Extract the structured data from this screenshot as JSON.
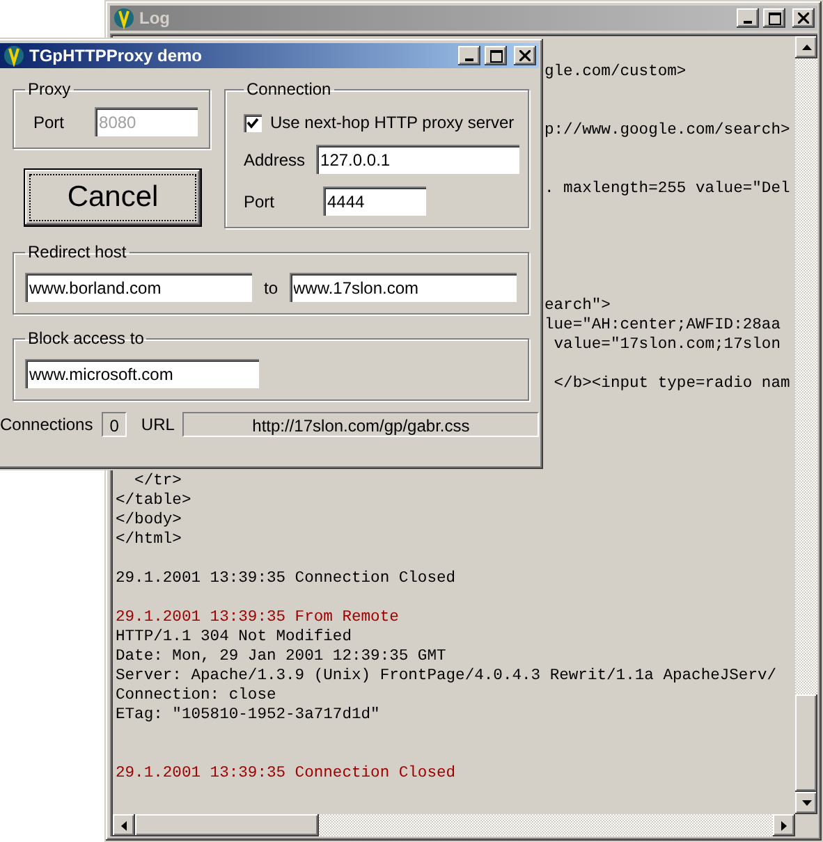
{
  "log_window": {
    "title": "Log",
    "active": false,
    "lines": [
      {
        "kind": "partial",
        "text": "gle.com/custom>",
        "color": "#000000"
      },
      {
        "kind": "blank"
      },
      {
        "kind": "blank"
      },
      {
        "kind": "partial",
        "text": "p://www.google.com/search>",
        "color": "#000000"
      },
      {
        "kind": "blank"
      },
      {
        "kind": "blank"
      },
      {
        "kind": "partial",
        "text": ". maxlength=255 value=\"Del",
        "color": "#000000"
      },
      {
        "kind": "blank"
      },
      {
        "kind": "blank"
      },
      {
        "kind": "blank"
      },
      {
        "kind": "blank"
      },
      {
        "kind": "blank"
      },
      {
        "kind": "partial",
        "text": "earch\">",
        "color": "#000000"
      },
      {
        "kind": "partial",
        "text": "lue=\"AH:center;AWFID:28aa",
        "color": "#000000"
      },
      {
        "kind": "partial",
        "text": " value=\"17slon.com;17slon",
        "color": "#000000"
      },
      {
        "kind": "blank"
      },
      {
        "kind": "partial",
        "text": " </b><input type=radio nam",
        "color": "#000000"
      },
      {
        "kind": "blank"
      },
      {
        "kind": "blank"
      },
      {
        "kind": "blank"
      },
      {
        "kind": "blank"
      },
      {
        "kind": "full",
        "text": "  </tr>",
        "color": "#000000"
      },
      {
        "kind": "full",
        "text": "</table>",
        "color": "#000000"
      },
      {
        "kind": "full",
        "text": "</body>",
        "color": "#000000"
      },
      {
        "kind": "full",
        "text": "</html>",
        "color": "#000000"
      },
      {
        "kind": "blank"
      },
      {
        "kind": "full",
        "text": "29.1.2001 13:39:35 Connection Closed",
        "color": "#000000"
      },
      {
        "kind": "blank"
      },
      {
        "kind": "full",
        "text": "29.1.2001 13:39:35 From Remote",
        "color": "#a00000"
      },
      {
        "kind": "full",
        "text": "HTTP/1.1 304 Not Modified",
        "color": "#000000"
      },
      {
        "kind": "full",
        "text": "Date: Mon, 29 Jan 2001 12:39:35 GMT",
        "color": "#000000"
      },
      {
        "kind": "full",
        "text": "Server: Apache/1.3.9 (Unix) FrontPage/4.0.4.3 Rewrit/1.1a ApacheJServ/",
        "color": "#000000"
      },
      {
        "kind": "full",
        "text": "Connection: close",
        "color": "#000000"
      },
      {
        "kind": "full",
        "text": "ETag: \"105810-1952-3a717d1d\"",
        "color": "#000000"
      },
      {
        "kind": "blank"
      },
      {
        "kind": "blank"
      },
      {
        "kind": "full",
        "text": "29.1.2001 13:39:35 Connection Closed",
        "color": "#a00000"
      }
    ]
  },
  "dialog": {
    "title": "TGpHTTPProxy demo",
    "active": true,
    "proxy": {
      "title": "Proxy",
      "port_label": "Port",
      "port": "8080",
      "disabled": true
    },
    "cancel_button": "Cancel",
    "connection": {
      "title": "Connection",
      "use_proxy_label": "Use next-hop HTTP proxy server",
      "use_proxy_checked": true,
      "address_label": "Address",
      "address": "127.0.0.1",
      "port_label": "Port",
      "port": "4444"
    },
    "redirect": {
      "title": "Redirect host",
      "from": "www.borland.com",
      "to_label": "to",
      "to": "www.17slon.com"
    },
    "block": {
      "title": "Block access to",
      "host": "www.microsoft.com"
    },
    "status_bar": {
      "connections_label": "Connections",
      "connections": "0",
      "url_label": "URL",
      "url": "http://17slon.com/gp/gabr.css"
    }
  }
}
